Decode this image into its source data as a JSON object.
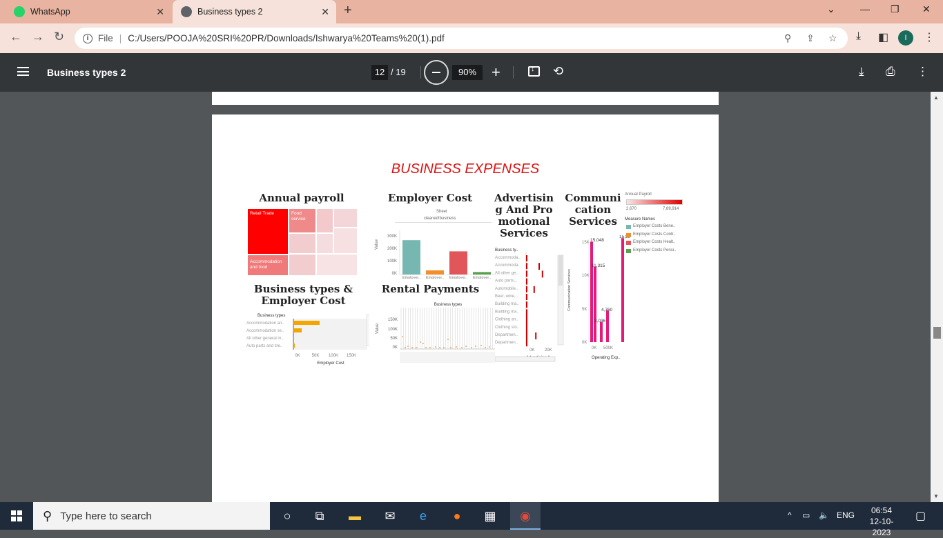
{
  "browser": {
    "tabs": [
      {
        "title": "WhatsApp"
      },
      {
        "title": "Business types 2"
      }
    ],
    "url_prefix": "File",
    "url": "C:/Users/POOJA%20SRI%20PR/Downloads/Ishwarya%20Teams%20(1).pdf",
    "profile_initial": "I"
  },
  "pdf_toolbar": {
    "title": "Business types 2",
    "page_current": "12",
    "page_total": "/ 19",
    "zoom": "90%"
  },
  "page": {
    "heading": "BUSINESS EXPENSES",
    "annual_payroll": {
      "title": "Annual payroll",
      "cells": [
        "Retail Trade",
        "Food service",
        "Accommodation and food"
      ]
    },
    "employer_cost": {
      "title": "Employer Cost",
      "header": "Sheet",
      "subheader": "cleaned!business",
      "ylabel": "Value",
      "yticks": [
        "300K",
        "200K",
        "100K",
        "0K"
      ],
      "categories": [
        "Employer..",
        "Employer..",
        "Employer..",
        "Employer.."
      ]
    },
    "advertising": {
      "title": "Advertising And Promotional Services",
      "title_lines": [
        "Advertisin",
        "g And Pro",
        "motional",
        "Services"
      ],
      "col_header": "Business ty..",
      "rows": [
        "Accommoda..",
        "Accommoda..",
        "All other ge..",
        "Auto parts,..",
        "Automobile..",
        "Beer, wine,..",
        "Building ma..",
        "Building ma..",
        "Clothing an..",
        "Clothing sto..",
        "Departmen..",
        "Departmen.."
      ],
      "xticks": [
        "0K",
        "20K"
      ],
      "xlabel": "Advertising A"
    },
    "communication": {
      "title_lines": [
        "Communi",
        "cation",
        "Services"
      ],
      "ylabel": "Communication Services",
      "yticks": [
        "15K",
        "10K",
        "5K",
        "0K"
      ],
      "labels": [
        "15,048",
        "15,598",
        "11,315",
        "4,760",
        "3,036"
      ],
      "xticks": [
        "0K",
        "500K"
      ],
      "xlabel": "Operating Exp.."
    },
    "legend": {
      "title": "Annual Payroll",
      "min": "2,670",
      "max": "7,89,914",
      "measure_title": "Measure Names",
      "items": [
        {
          "label": "Employer Costs Bene..",
          "color": "#76b7b2"
        },
        {
          "label": "Employer Costs Contr..",
          "color": "#f28e2b"
        },
        {
          "label": "Employer Costs Healt..",
          "color": "#e15759"
        },
        {
          "label": "Employer Costs Pensi..",
          "color": "#59a14f"
        }
      ]
    },
    "business_types_cost": {
      "title_lines": [
        "Business types &",
        "Employer Cost"
      ],
      "col_header": "Business types",
      "rows": [
        "Accommodation an..",
        "Accommodation se..",
        "All other general m..",
        "Auto parts and tire.."
      ],
      "xticks": [
        "0K",
        "50K",
        "100K",
        "150K"
      ],
      "xlabel": "Employer Cost"
    },
    "rental": {
      "title": "Rental Payments",
      "header": "Business types",
      "ylabel": "Value",
      "yticks": [
        "150K",
        "100K",
        "50K",
        "0K"
      ]
    }
  },
  "taskbar": {
    "search_placeholder": "Type here to search",
    "lang": "ENG",
    "time": "06:54",
    "date": "12-10-2023"
  }
}
